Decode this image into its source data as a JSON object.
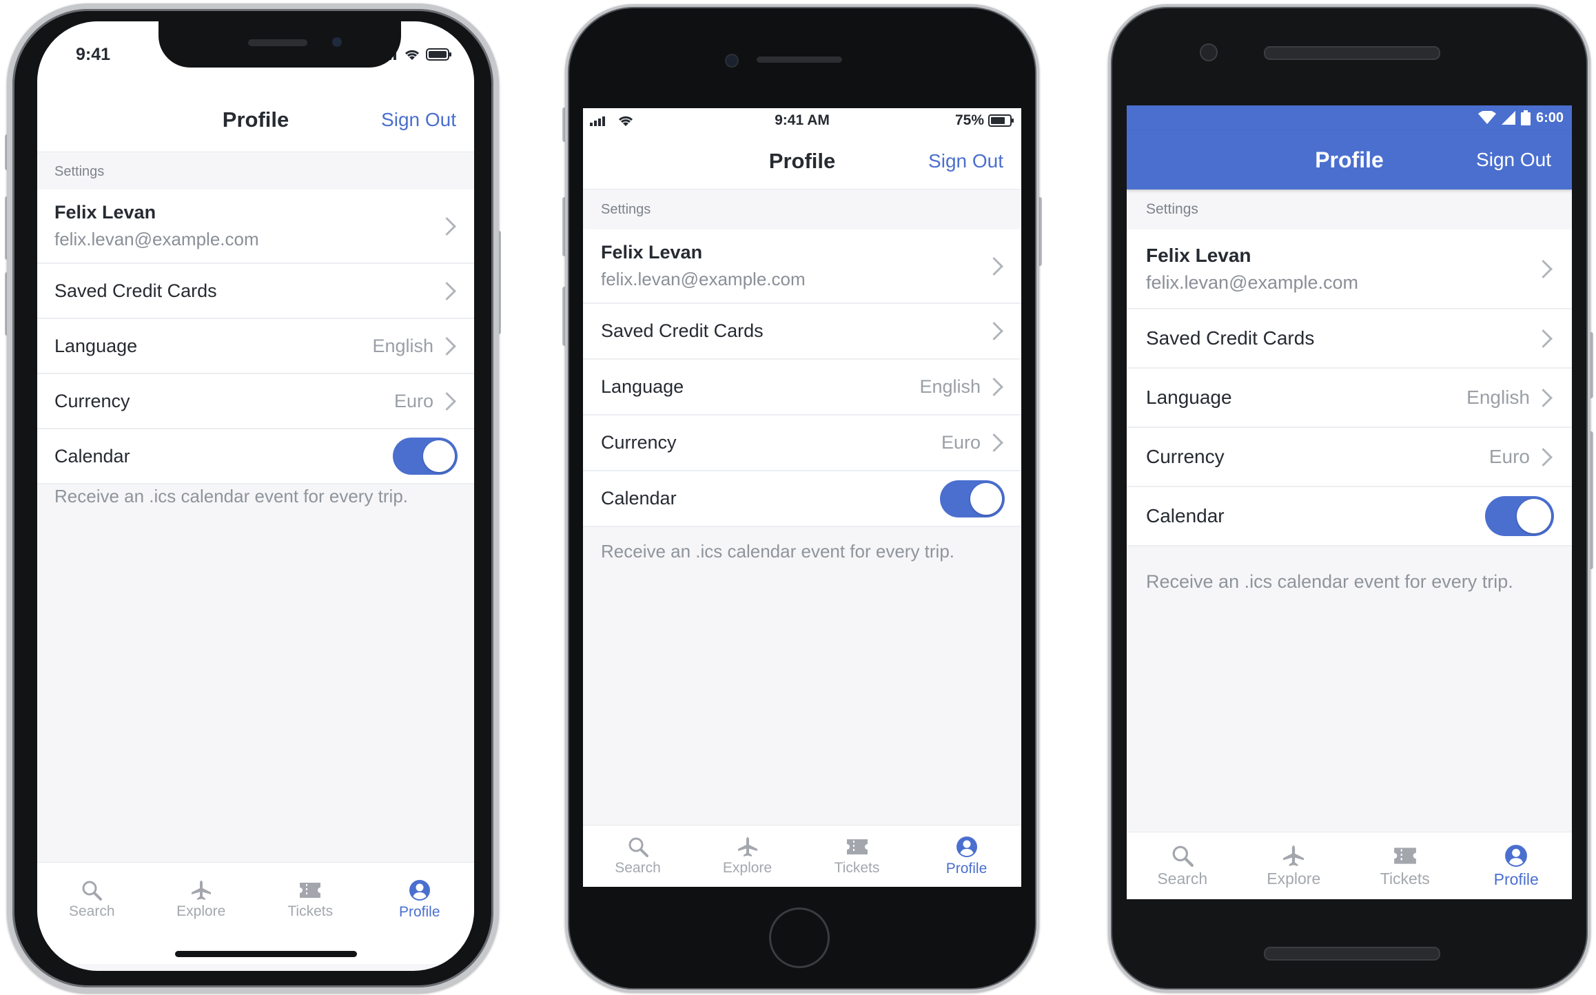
{
  "accent_color": "#4a6fcf",
  "devices": {
    "iphone_x": {
      "status_time": "9:41",
      "title": "Profile",
      "sign_out": "Sign Out",
      "section": "Settings",
      "user_name": "Felix Levan",
      "user_email": "felix.levan@example.com",
      "saved_cards": "Saved Credit Cards",
      "language_label": "Language",
      "language_value": "English",
      "currency_label": "Currency",
      "currency_value": "Euro",
      "calendar_label": "Calendar",
      "calendar_on": true,
      "note": "Receive an .ics calendar event for every trip.",
      "tabs": [
        "Search",
        "Explore",
        "Tickets",
        "Profile"
      ],
      "active_tab": "Profile"
    },
    "iphone_8": {
      "status_time": "9:41 AM",
      "battery": "75%",
      "title": "Profile",
      "sign_out": "Sign Out",
      "section": "Settings",
      "user_name": "Felix Levan",
      "user_email": "felix.levan@example.com",
      "saved_cards": "Saved Credit Cards",
      "language_label": "Language",
      "language_value": "English",
      "currency_label": "Currency",
      "currency_value": "Euro",
      "calendar_label": "Calendar",
      "calendar_on": true,
      "note": "Receive an .ics calendar event for every trip.",
      "tabs": [
        "Search",
        "Explore",
        "Tickets",
        "Profile"
      ],
      "active_tab": "Profile"
    },
    "android": {
      "status_time": "6:00",
      "title": "Profile",
      "sign_out": "Sign Out",
      "section": "Settings",
      "user_name": "Felix Levan",
      "user_email": "felix.levan@example.com",
      "saved_cards": "Saved Credit Cards",
      "language_label": "Language",
      "language_value": "English",
      "currency_label": "Currency",
      "currency_value": "Euro",
      "calendar_label": "Calendar",
      "calendar_on": true,
      "note": "Receive an .ics calendar event for every trip.",
      "tabs": [
        "Search",
        "Explore",
        "Tickets",
        "Profile"
      ],
      "active_tab": "Profile"
    }
  },
  "icons": [
    "search-icon",
    "plane-icon",
    "ticket-icon",
    "user-circle-icon",
    "chevron-right-icon",
    "signal-icon",
    "wifi-icon",
    "battery-icon"
  ]
}
